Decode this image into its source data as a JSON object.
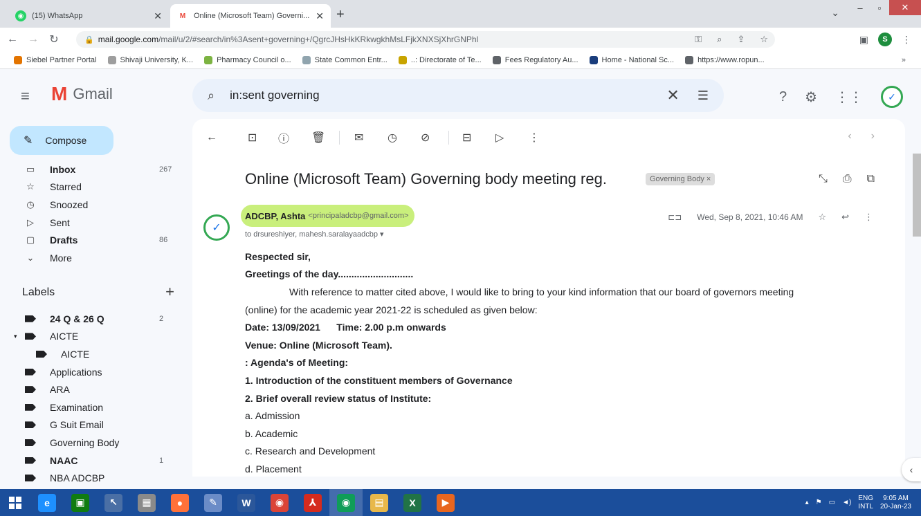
{
  "browser": {
    "tabs": [
      {
        "title": "(15) WhatsApp",
        "favicon_color": "#25d366",
        "active": false
      },
      {
        "title": "Online (Microsoft Team) Governi...",
        "favicon_color": "#ea4335",
        "active": true
      }
    ],
    "new_tab": "+",
    "url_host": "mail.google.com",
    "url_path": "/mail/u/2/#search/in%3Asent+governing+/QgrcJHsHkKRkwgkhMsLFjkXNXSjXhrGNPhl",
    "profile_initial": "S",
    "bookmarks": [
      {
        "label": "Siebel Partner Portal",
        "color": "#e37400"
      },
      {
        "label": "Shivaji University, K...",
        "color": "#9e9e9e"
      },
      {
        "label": "Pharmacy Council o...",
        "color": "#7cb342"
      },
      {
        "label": "State Common Entr...",
        "color": "#90a4ae"
      },
      {
        "label": "..: Directorate of Te...",
        "color": "#c8a400"
      },
      {
        "label": "Fees Regulatory Au...",
        "color": "#5f6368"
      },
      {
        "label": "Home - National Sc...",
        "color": "#1a3d7c"
      },
      {
        "label": "https://www.ropun...",
        "color": "#5f6368"
      }
    ],
    "bookmarks_more": "»"
  },
  "gmail": {
    "brand": "Gmail",
    "search_value": "in:sent governing",
    "compose": "Compose",
    "nav": [
      {
        "label": "Inbox",
        "count": "267",
        "bold": true,
        "icon": "inbox-icon",
        "glyph": "▭"
      },
      {
        "label": "Starred",
        "count": "",
        "bold": false,
        "icon": "star-icon",
        "glyph": "☆"
      },
      {
        "label": "Snoozed",
        "count": "",
        "bold": false,
        "icon": "clock-icon",
        "glyph": "◷"
      },
      {
        "label": "Sent",
        "count": "",
        "bold": false,
        "icon": "send-icon",
        "glyph": "▷"
      },
      {
        "label": "Drafts",
        "count": "86",
        "bold": true,
        "icon": "draft-icon",
        "glyph": "▢"
      },
      {
        "label": "More",
        "count": "",
        "bold": false,
        "icon": "chevron-down-icon",
        "glyph": "⌄"
      }
    ],
    "labels_title": "Labels",
    "labels_add": "+",
    "labels": [
      {
        "label": "24 Q & 26 Q",
        "count": "2",
        "bold": true,
        "sub": false,
        "caret": false
      },
      {
        "label": "AICTE",
        "count": "",
        "bold": false,
        "sub": false,
        "caret": true
      },
      {
        "label": "AICTE",
        "count": "",
        "bold": false,
        "sub": true,
        "caret": false
      },
      {
        "label": "Applications",
        "count": "",
        "bold": false,
        "sub": false,
        "caret": false
      },
      {
        "label": "ARA",
        "count": "",
        "bold": false,
        "sub": false,
        "caret": false
      },
      {
        "label": "Examination",
        "count": "",
        "bold": false,
        "sub": false,
        "caret": false
      },
      {
        "label": "G Suit Email",
        "count": "",
        "bold": false,
        "sub": false,
        "caret": false
      },
      {
        "label": "Governing Body",
        "count": "",
        "bold": false,
        "sub": false,
        "caret": false
      },
      {
        "label": "NAAC",
        "count": "1",
        "bold": true,
        "sub": false,
        "caret": false
      },
      {
        "label": "NBA ADCBP",
        "count": "",
        "bold": false,
        "sub": false,
        "caret": false
      }
    ]
  },
  "email": {
    "subject": "Online (Microsoft Team) Governing body meeting reg.",
    "label_chip": "Governing Body ×",
    "sender_name": "ADCBP, Ashta",
    "sender_email": "<principaladcbp@gmail.com>",
    "recipients": "to drsureshiyer, mahesh.saralayaadcbp ▾",
    "date": "Wed, Sep 8, 2021, 10:46 AM",
    "body": [
      {
        "text": "Respected sir,",
        "bold": true,
        "indent": false
      },
      {
        "text": "Greetings of the day............................",
        "bold": true,
        "indent": false
      },
      {
        "text": "With reference to matter cited above, I would like to bring to your kind information that our board of governors meeting",
        "bold": false,
        "indent": true
      },
      {
        "text": "(online) for the academic year 2021-22 is scheduled as given below:",
        "bold": false,
        "indent": false
      },
      {
        "text": "Date: 13/09/2021      Time: 2.00 p.m onwards",
        "bold": true,
        "indent": false
      },
      {
        "text": "Venue: Online (Microsoft Team).",
        "bold": true,
        "indent": false
      },
      {
        "text": ": Agenda's of Meeting:",
        "bold": true,
        "indent": false
      },
      {
        "text": "1. Introduction of the constituent members of Governance",
        "bold": true,
        "indent": false
      },
      {
        "text": "2. Brief overall review status of Institute:",
        "bold": true,
        "indent": false
      },
      {
        "text": "a. Admission",
        "bold": false,
        "indent": false
      },
      {
        "text": "b. Academic",
        "bold": false,
        "indent": false
      },
      {
        "text": "c. Research and Development",
        "bold": false,
        "indent": false
      },
      {
        "text": "d. Placement",
        "bold": false,
        "indent": false
      }
    ]
  },
  "taskbar": {
    "apps": [
      {
        "name": "internet-explorer-icon",
        "glyph": "e",
        "color": "#1e90ff",
        "active": false
      },
      {
        "name": "store-icon",
        "glyph": "▣",
        "color": "#107c10",
        "active": false
      },
      {
        "name": "cursor-tool-icon",
        "glyph": "↖",
        "color": "#4a6fa5",
        "active": false
      },
      {
        "name": "calculator-icon",
        "glyph": "▦",
        "color": "#8a8a8a",
        "active": false
      },
      {
        "name": "firefox-icon",
        "glyph": "●",
        "color": "#ff7139",
        "active": false
      },
      {
        "name": "paint-icon",
        "glyph": "✎",
        "color": "#6b8cc7",
        "active": false
      },
      {
        "name": "word-icon",
        "glyph": "W",
        "color": "#2b579a",
        "active": false
      },
      {
        "name": "chrome-icon",
        "glyph": "◉",
        "color": "#db4437",
        "active": false
      },
      {
        "name": "acrobat-icon",
        "glyph": "⅄",
        "color": "#d52b1e",
        "active": false
      },
      {
        "name": "chrome-profile-icon",
        "glyph": "◉",
        "color": "#0f9d58",
        "active": true
      },
      {
        "name": "file-explorer-icon",
        "glyph": "▤",
        "color": "#e8b84a",
        "active": false
      },
      {
        "name": "excel-icon",
        "glyph": "X",
        "color": "#217346",
        "active": false
      },
      {
        "name": "media-icon",
        "glyph": "▶",
        "color": "#e8661f",
        "active": false
      }
    ],
    "lang_top": "ENG",
    "lang_bottom": "INTL",
    "time": "9:05 AM",
    "date": "20-Jan-23"
  }
}
